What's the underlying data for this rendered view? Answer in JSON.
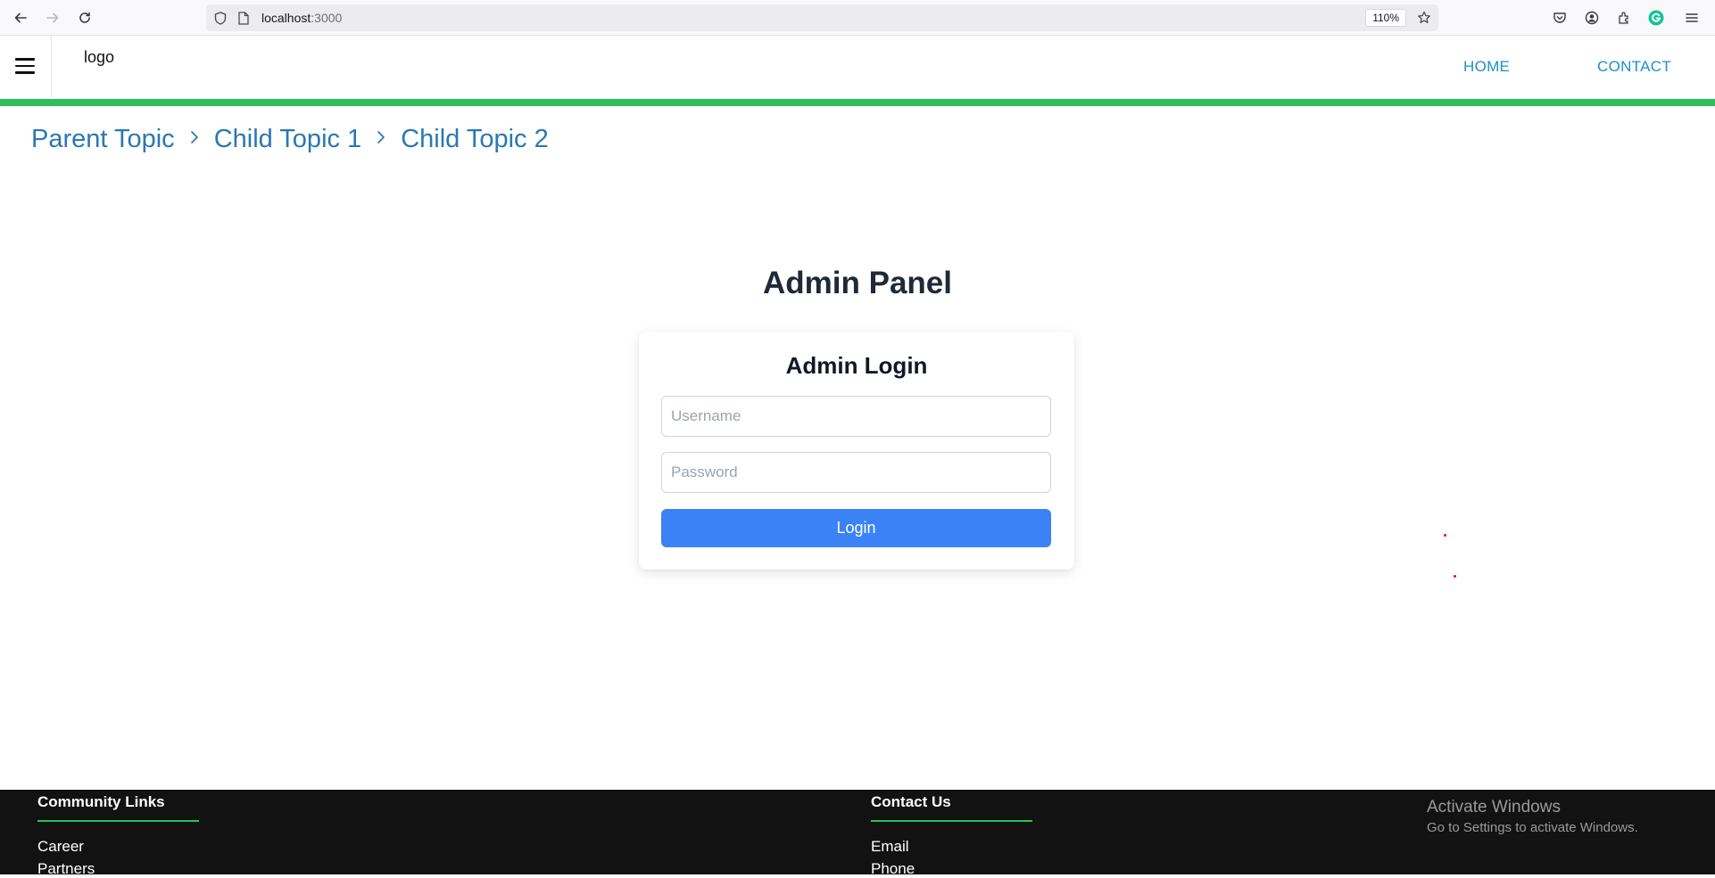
{
  "browser": {
    "url_host": "localhost",
    "url_port": ":3000",
    "zoom": "110%"
  },
  "header": {
    "logo": "logo",
    "nav": [
      {
        "label": "HOME"
      },
      {
        "label": "CONTACT"
      }
    ]
  },
  "breadcrumb": [
    "Parent Topic",
    "Child Topic 1",
    "Child Topic 2"
  ],
  "main": {
    "title": "Admin Panel",
    "login": {
      "title": "Admin Login",
      "username_placeholder": "Username",
      "password_placeholder": "Password",
      "button_label": "Login"
    }
  },
  "footer": {
    "columns": [
      {
        "heading": "Community Links",
        "links": [
          "Career",
          "Partners"
        ]
      },
      {
        "heading": "Contact Us",
        "links": [
          "Email",
          "Phone"
        ]
      }
    ]
  },
  "watermark": {
    "title": "Activate Windows",
    "subtitle": "Go to Settings to activate Windows."
  },
  "colors": {
    "accent_green": "#2bbf5c",
    "link_blue": "#1f8fc8",
    "button_blue": "#3b82f6",
    "footer_bg": "#121212"
  }
}
